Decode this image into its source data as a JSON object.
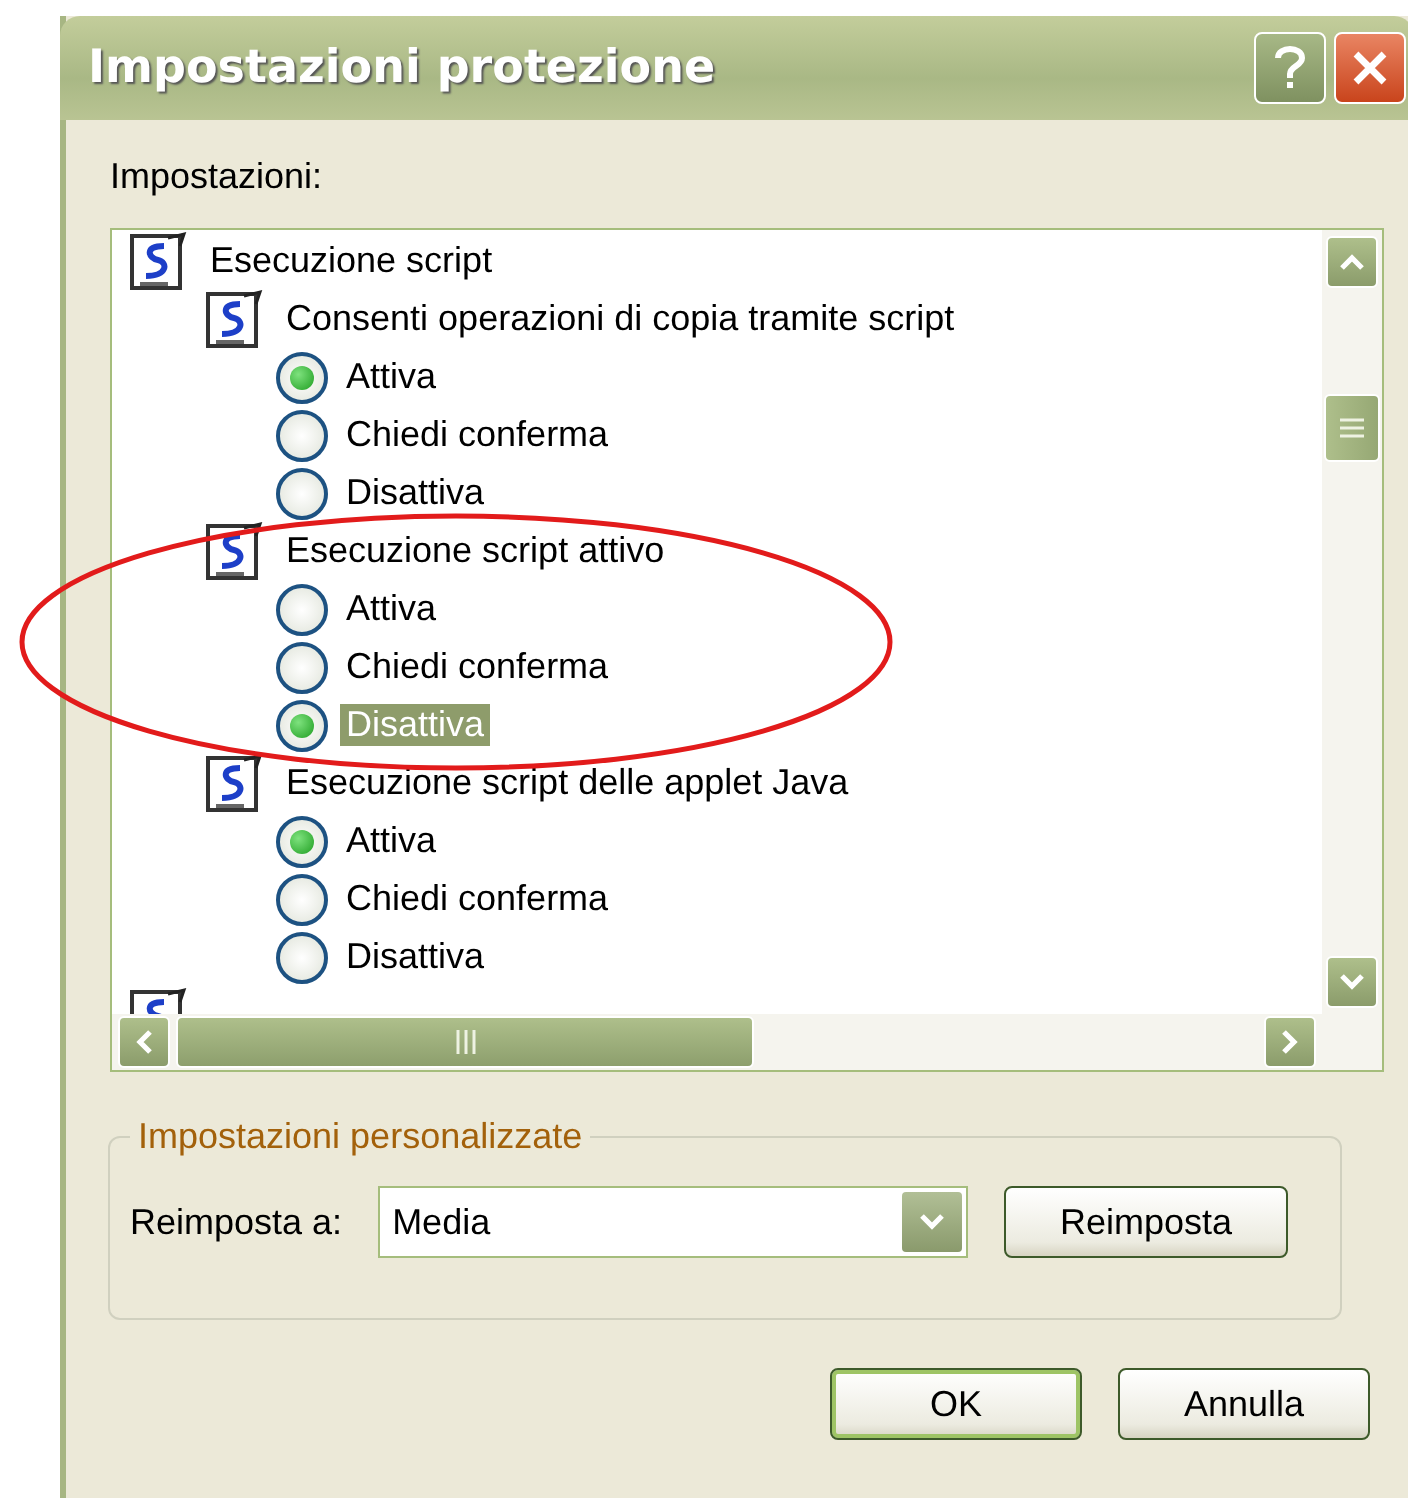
{
  "window": {
    "title": "Impostazioni protezione"
  },
  "settings": {
    "label": "Impostazioni:",
    "tree": [
      {
        "kind": "category",
        "label": "Esecuzione script",
        "children": [
          {
            "kind": "setting",
            "label": "Consenti operazioni di copia tramite script",
            "options": [
              {
                "label": "Attiva",
                "selected": true,
                "highlighted": false
              },
              {
                "label": "Chiedi conferma",
                "selected": false,
                "highlighted": false
              },
              {
                "label": "Disattiva",
                "selected": false,
                "highlighted": false
              }
            ]
          },
          {
            "kind": "setting",
            "label": "Esecuzione script attivo",
            "options": [
              {
                "label": "Attiva",
                "selected": false,
                "highlighted": false
              },
              {
                "label": "Chiedi conferma",
                "selected": false,
                "highlighted": false
              },
              {
                "label": "Disattiva",
                "selected": true,
                "highlighted": true
              }
            ]
          },
          {
            "kind": "setting",
            "label": "Esecuzione script delle applet Java",
            "options": [
              {
                "label": "Attiva",
                "selected": true,
                "highlighted": false
              },
              {
                "label": "Chiedi conferma",
                "selected": false,
                "highlighted": false
              },
              {
                "label": "Disattiva",
                "selected": false,
                "highlighted": false
              }
            ]
          }
        ]
      }
    ]
  },
  "custom": {
    "legend": "Impostazioni personalizzate",
    "reset_label": "Reimposta a:",
    "reset_value": "Media",
    "reset_button": "Reimposta"
  },
  "buttons": [
    {
      "label": "OK",
      "default": true
    },
    {
      "label": "Annulla",
      "default": false
    }
  ]
}
